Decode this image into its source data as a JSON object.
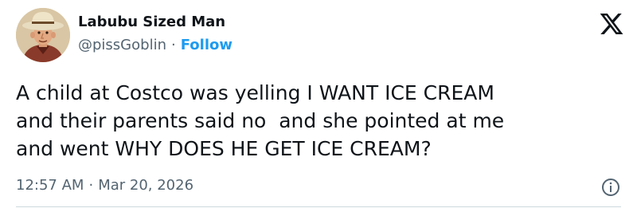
{
  "tweet": {
    "author": {
      "display_name": "Labubu Sized Man",
      "handle": "@pissGoblin",
      "separator": "·",
      "follow_label": "Follow",
      "avatar_icon": "cowboy-avatar-icon"
    },
    "brand_icon": "x-logo-icon",
    "text": "A child at Costco was yelling I WANT ICE CREAM\nand their parents said no  and she pointed at me\nand went WHY DOES HE GET ICE CREAM?",
    "time": "12:57 AM",
    "time_separator": "·",
    "date": "Mar 20, 2026",
    "info_icon": "info-icon",
    "colors": {
      "accent": "#1d9bf0",
      "text": "#0f1419",
      "secondary": "#536471",
      "divider": "#cfd9de"
    }
  }
}
